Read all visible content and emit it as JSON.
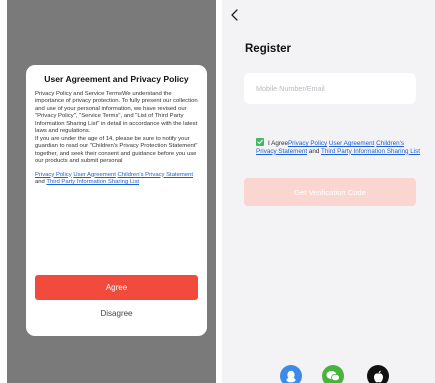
{
  "modal": {
    "title": "User Agreement and Privacy Policy",
    "body": [
      "Privacy Policy and Service TermsWe understand the importance of privacy protection. To fully present our collection and use of your personal information, we have revised our \"Privacy Policy\", \"Service Terms\", and \"List of Third Party Information Sharing List\" in detail in accordance with the latest laws and regulations.",
      "If you are under the age of 14, please be sure to notify your guardian to read our \"Children's Privacy Protection Statement\" together, and seek their consent and guidance before you use our products and submit personal"
    ],
    "links": {
      "privacy_policy": "Privacy Policy",
      "user_agreement": "User Agreement",
      "children_privacy": "Children's Privacy Statement",
      "and": "and",
      "third_party": "Third Party Information Sharing List"
    },
    "agree_label": "Agree",
    "disagree_label": "Disagree"
  },
  "register": {
    "back_icon": "chevron-left-icon",
    "title": "Register",
    "input": {
      "placeholder": "Mobile Number/Email",
      "value": ""
    },
    "agreement": {
      "checked": true,
      "prefix": "I Agree",
      "privacy_policy": "Privacy Policy",
      "user_agreement": "User Agreement",
      "children_privacy": "Children's Privacy Statement",
      "and": "and",
      "third_party": "Third Party Information Sharing List"
    },
    "verify_button": "Get Verification Code",
    "social": [
      {
        "name": "qq-icon",
        "color": "#3d8be6"
      },
      {
        "name": "wechat-icon",
        "color": "#4ab33d"
      },
      {
        "name": "apple-icon",
        "color": "#111111"
      }
    ]
  },
  "colors": {
    "accent_red": "#f24a3d",
    "disabled_red": "#fbd6d1",
    "link_blue": "#1d5fd6",
    "check_green": "#3fb95a",
    "overlay_gray": "#7a7a7a"
  }
}
